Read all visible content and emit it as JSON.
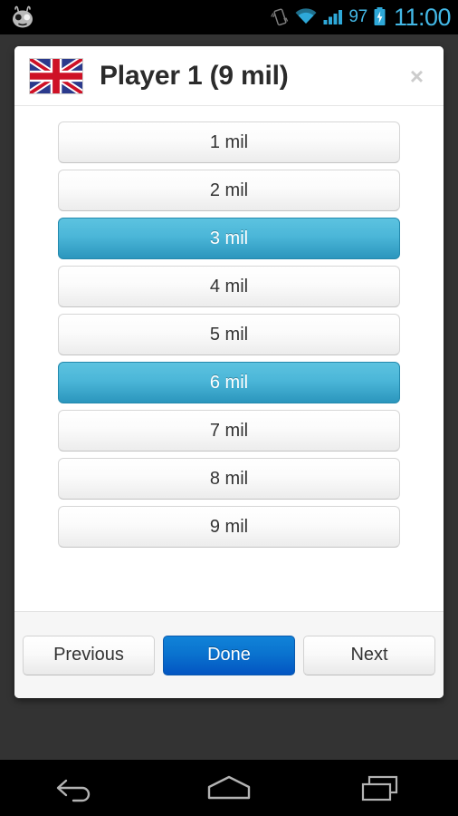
{
  "statusbar": {
    "logo_icon": "cyanogenmod-logo",
    "vibrate_icon": "vibrate-icon",
    "wifi_icon": "wifi-icon",
    "signal_icon": "cellular-signal-icon",
    "battery_icon": "battery-charging-icon",
    "battery_level": "97",
    "time": "11:00",
    "accent_color": "#43b8e6"
  },
  "dialog": {
    "flag_icon": "union-jack-flag-icon",
    "title": "Player 1 (9 mil)",
    "close_label": "×",
    "options": [
      {
        "label": "1 mil",
        "selected": false
      },
      {
        "label": "2 mil",
        "selected": false
      },
      {
        "label": "3 mil",
        "selected": true
      },
      {
        "label": "4 mil",
        "selected": false
      },
      {
        "label": "5 mil",
        "selected": false
      },
      {
        "label": "6 mil",
        "selected": true
      },
      {
        "label": "7 mil",
        "selected": false
      },
      {
        "label": "8 mil",
        "selected": false
      },
      {
        "label": "9 mil",
        "selected": false
      }
    ],
    "footer": {
      "previous_label": "Previous",
      "done_label": "Done",
      "next_label": "Next"
    },
    "selected_color": "#3fadd0",
    "primary_color": "#0a73cf"
  },
  "navbar": {
    "back_icon": "back-arrow-icon",
    "home_icon": "home-icon",
    "recents_icon": "recent-apps-icon"
  }
}
